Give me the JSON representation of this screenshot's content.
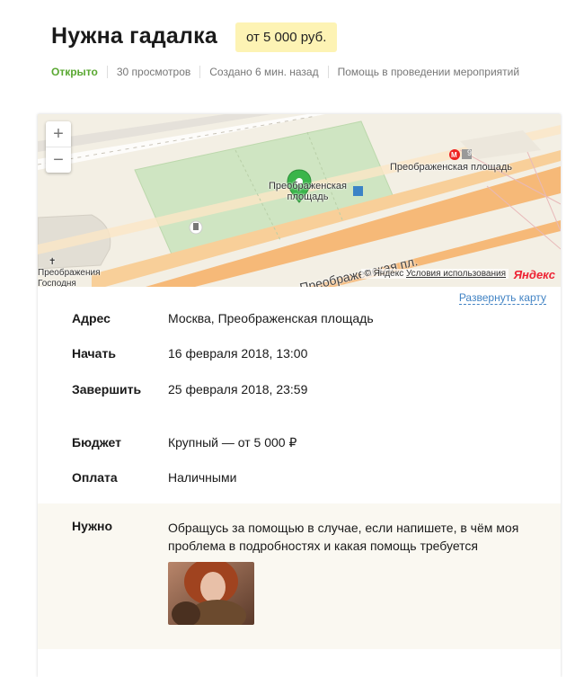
{
  "header": {
    "title": "Нужна гадалка",
    "price": "от 5 000 руб."
  },
  "meta": {
    "status": "Открыто",
    "views": "30 просмотров",
    "created": "Создано 6 мин. назад",
    "category": "Помощь в проведении мероприятий"
  },
  "map": {
    "zoom_in": "+",
    "zoom_out": "−",
    "label_square_line1": "Преображенская",
    "label_square_line2": "площадь",
    "label_metro": "Преображенская площадь",
    "metro_line": "9",
    "label_street": "Преображенская пл.",
    "label_church_line1": "Преображения",
    "label_church_line2": "Господня",
    "copyright": "© Яндекс",
    "terms": "Условия использования",
    "logo": "Яндекс",
    "expand": "Развернуть карту"
  },
  "details": {
    "address_label": "Адрес",
    "address_value": "Москва, Преображенская площадь",
    "start_label": "Начать",
    "start_value": "16 февраля 2018, 13:00",
    "end_label": "Завершить",
    "end_value": "25 февраля 2018, 23:59",
    "budget_label": "Бюджет",
    "budget_value": "Крупный — от 5 000 ₽",
    "payment_label": "Оплата",
    "payment_value": "Наличными"
  },
  "need": {
    "label": "Нужно",
    "text": "Обращусь за помощью в случае, если напишете, в чём моя проблема в подробностях и какая помощь требуется"
  },
  "colors": {
    "status_open": "#5aa832",
    "price_bg": "#fdf3b4",
    "link": "#4183c4",
    "pin": "#3ab54a"
  }
}
